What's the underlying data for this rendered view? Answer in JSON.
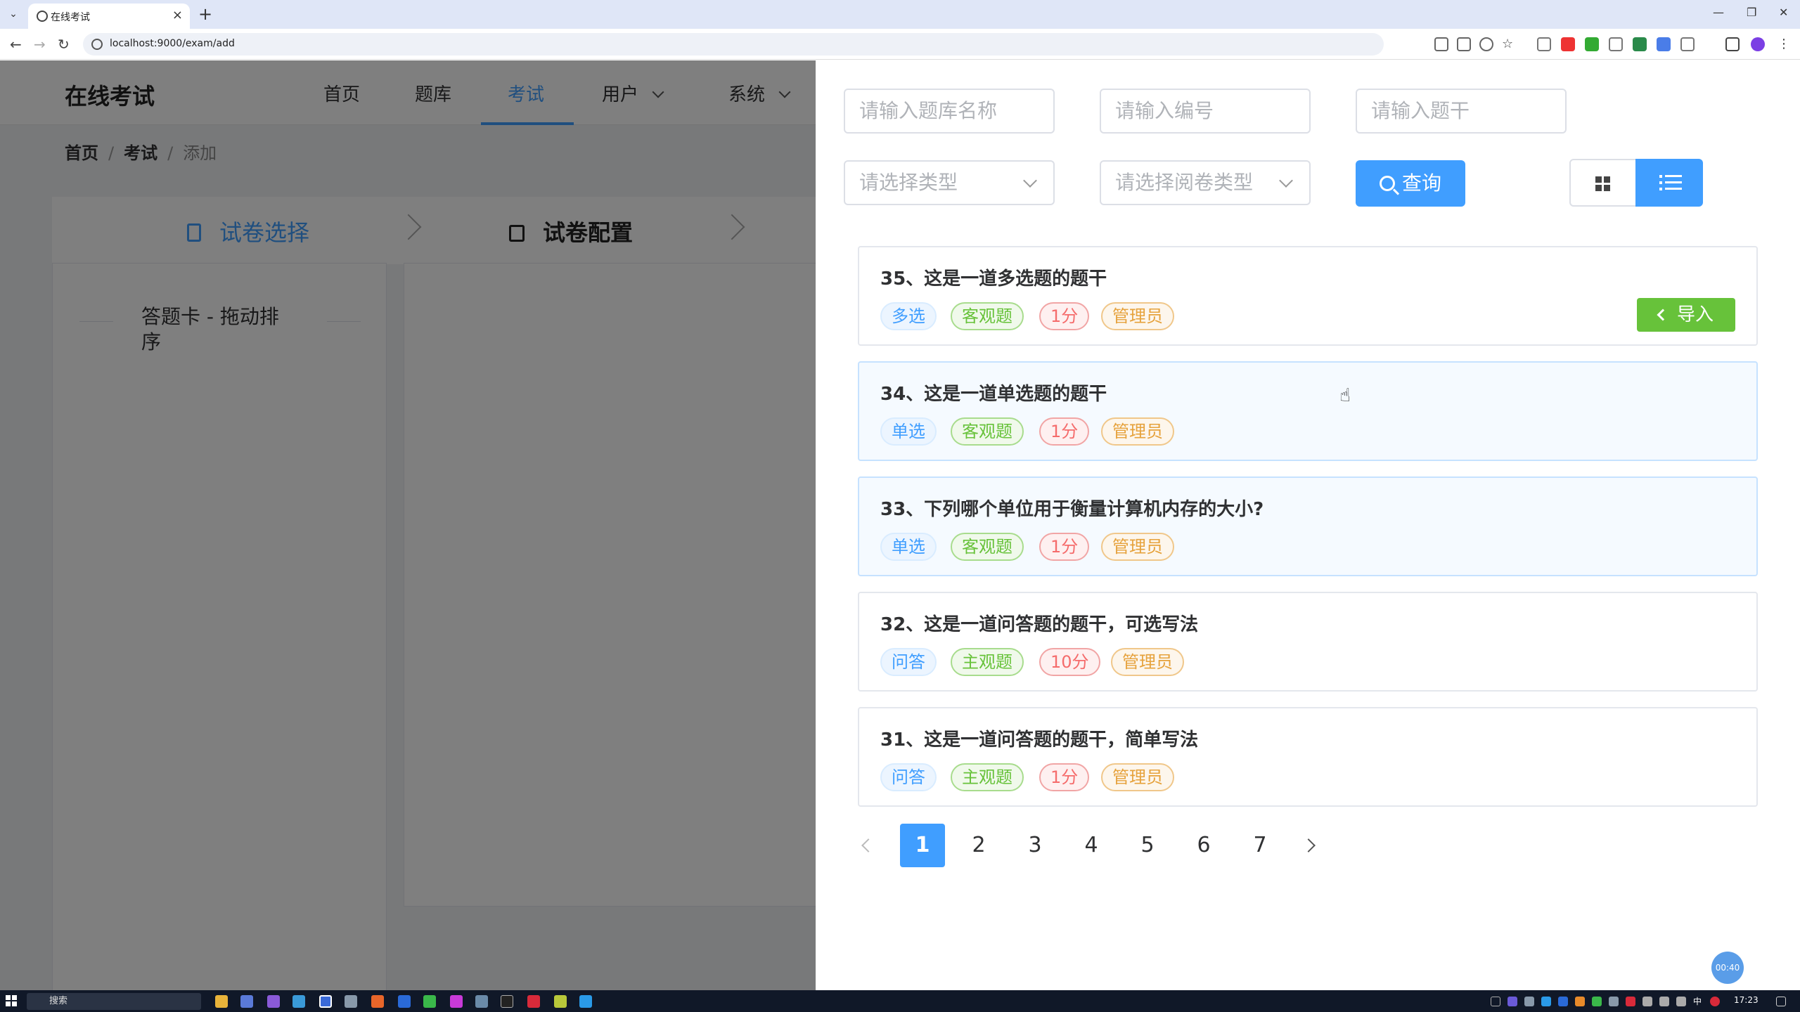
{
  "browser": {
    "tab_title": "在线考试",
    "url": "localhost:9000/exam/add"
  },
  "app": {
    "logo": "在线考试",
    "menu": {
      "home": "首页",
      "bank": "题库",
      "exam": "考试",
      "user": "用户",
      "system": "系统"
    },
    "breadcrumb": {
      "home": "首页",
      "exam": "考试",
      "current": "添加",
      "separator": "/"
    },
    "steps": {
      "step1": "试卷选择",
      "step2": "试卷配置"
    },
    "answer_card_title": "答题卡 - 拖动排序"
  },
  "drawer": {
    "filters": {
      "bank_name_placeholder": "请输入题库名称",
      "code_placeholder": "请输入编号",
      "stem_placeholder": "请输入题干",
      "type_placeholder": "请选择类型",
      "review_type_placeholder": "请选择阅卷类型"
    },
    "search_label": "查询",
    "view_mode": "list",
    "import_label": "导入",
    "questions": [
      {
        "title": "35、这是一道多选题的题干",
        "type": "多选",
        "category": "客观题",
        "score": "1分",
        "author": "管理员"
      },
      {
        "title": "34、这是一道单选题的题干",
        "type": "单选",
        "category": "客观题",
        "score": "1分",
        "author": "管理员"
      },
      {
        "title": "33、下列哪个单位用于衡量计算机内存的大小?",
        "type": "单选",
        "category": "客观题",
        "score": "1分",
        "author": "管理员"
      },
      {
        "title": "32、这是一道问答题的题干，可选写法",
        "type": "问答",
        "category": "主观题",
        "score": "10分",
        "author": "管理员"
      },
      {
        "title": "31、这是一道问答题的题干，简单写法",
        "type": "问答",
        "category": "主观题",
        "score": "1分",
        "author": "管理员"
      }
    ],
    "pagination": {
      "pages": [
        "1",
        "2",
        "3",
        "4",
        "5",
        "6",
        "7"
      ],
      "current": "1"
    }
  },
  "timer": "00:40",
  "taskbar": {
    "search_label": "搜索",
    "clock": "17:23",
    "ime": "中"
  },
  "colors": {
    "primary": "#409eff",
    "success": "#67c23a",
    "danger": "#f56c6c",
    "warning": "#e6a23c"
  }
}
